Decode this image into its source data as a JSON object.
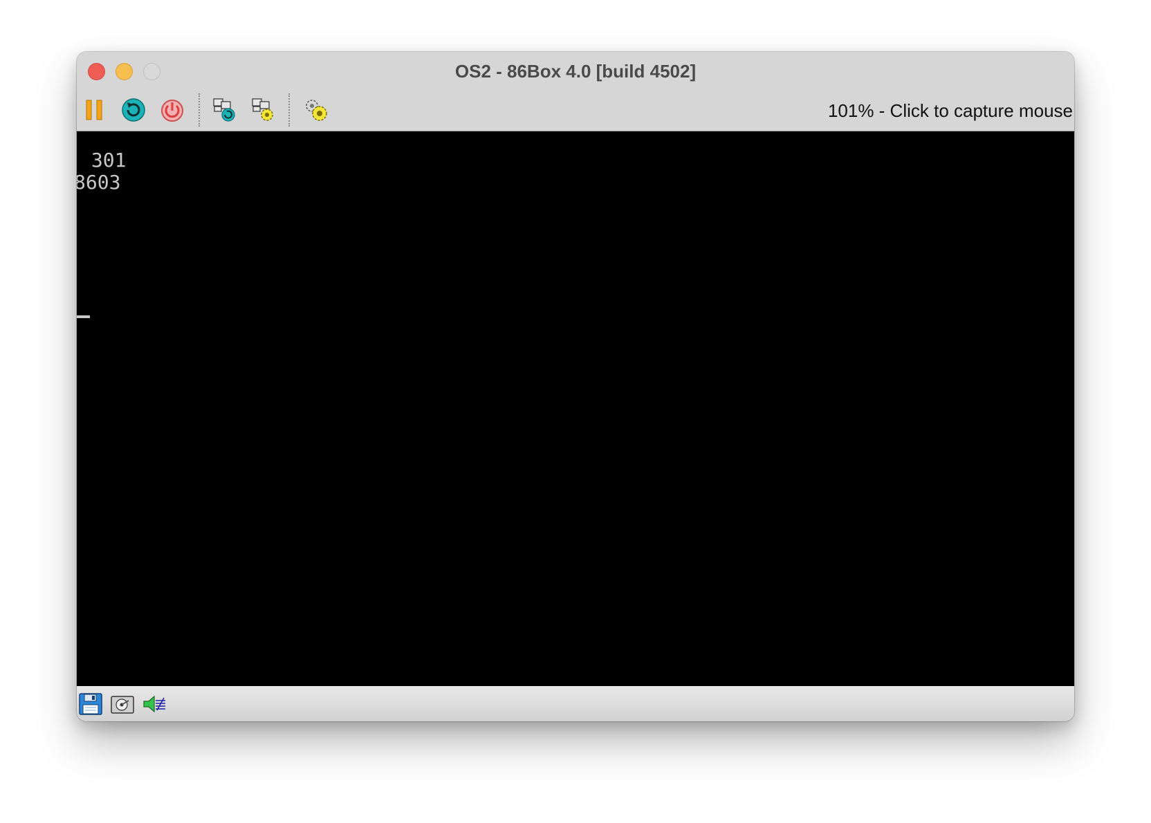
{
  "window": {
    "title": "OS2 - 86Box 4.0 [build 4502]"
  },
  "toolbar": {
    "buttons": [
      {
        "name": "pause",
        "icon": "pause-icon",
        "color": "#f2a51a"
      },
      {
        "name": "reset",
        "icon": "reset-icon",
        "color": "#1bb3b8"
      },
      {
        "name": "power",
        "icon": "power-icon",
        "color": "#e06060"
      },
      {
        "name": "ctrl-alt-del",
        "icon": "ctrl-alt-del-icon"
      },
      {
        "name": "machine-settings",
        "icon": "machine-settings-icon"
      },
      {
        "name": "settings",
        "icon": "settings-gear-icon"
      }
    ],
    "status_text": "101% - Click to capture mouse"
  },
  "screen": {
    "background": "#000000",
    "text_color": "#c8c8c8",
    "lines": [
      " 301",
      "8603"
    ]
  },
  "statusbar": {
    "icons": [
      "floppy-drive-icon",
      "hard-disk-icon",
      "sound-icon"
    ]
  }
}
